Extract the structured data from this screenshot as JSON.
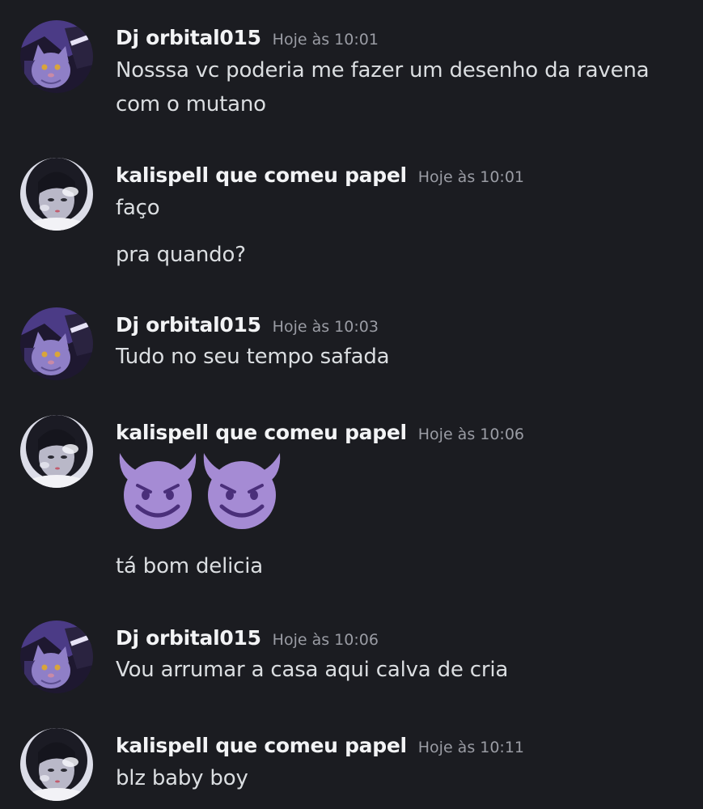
{
  "messages": [
    {
      "author": "Dj orbital015",
      "time": "Hoje às 10:01",
      "lines": [
        "Nosssa vc poderia me fazer um desenho da ravena",
        "com o mutano"
      ],
      "avatar": "cat-avatar"
    },
    {
      "author": "kalispell que comeu papel",
      "time": "Hoje às 10:01",
      "lines": [
        "faço",
        "pra quando?"
      ],
      "avatar": "girl-avatar"
    },
    {
      "author": "Dj orbital015",
      "time": "Hoje às 10:03",
      "lines": [
        "Tudo no seu tempo safada"
      ],
      "avatar": "cat-avatar"
    },
    {
      "author": "kalispell que comeu papel",
      "time": "Hoje às 10:06",
      "emojis": [
        "smiling-imp-emoji",
        "smiling-imp-emoji"
      ],
      "lines": [
        "tá bom delicia"
      ],
      "avatar": "girl-avatar"
    },
    {
      "author": "Dj orbital015",
      "time": "Hoje às 10:06",
      "lines": [
        "Vou arrumar  a casa aqui calva de cria"
      ],
      "avatar": "cat-avatar"
    },
    {
      "author": "kalispell que comeu papel",
      "time": "Hoje às 10:11",
      "lines": [
        "blz baby boy"
      ],
      "avatar": "girl-avatar"
    }
  ],
  "colors": {
    "background": "#1b1c21",
    "author": "#f2f3f5",
    "timestamp": "#9a9ca4",
    "text": "#dbdee1",
    "emoji": "#a78bd6"
  }
}
